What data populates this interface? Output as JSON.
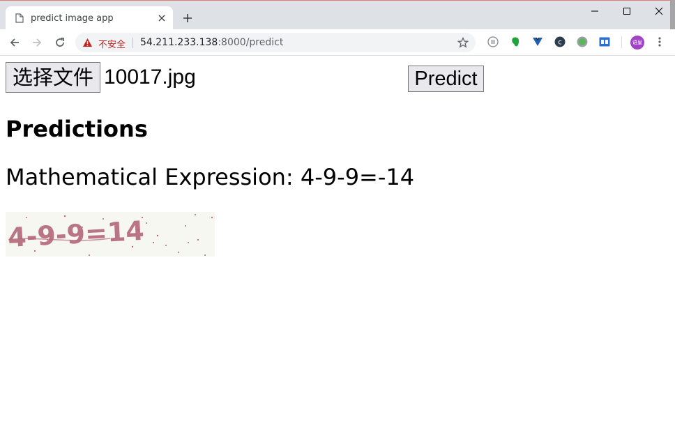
{
  "browser": {
    "tab_title": "predict image app",
    "security_label": "不安全",
    "url_host": "54.211.233.138",
    "url_rest": ":8000/predict",
    "avatar_text": "语皇",
    "extension_icons": [
      "reader-mode-icon",
      "evernote-icon",
      "vuejs-devtools-icon",
      "translate-icon",
      "green-dot-extension-icon",
      "reading-list-icon"
    ]
  },
  "form": {
    "file_button_label": "选择文件",
    "file_name": "10017.jpg",
    "submit_label": "Predict"
  },
  "result": {
    "heading": "Predictions",
    "expression_text": "Mathematical Expression: 4-9-9=-14",
    "captcha_text": "4-9-9=14"
  },
  "colors": {
    "tabstrip_bg": "#dee1e6",
    "insecure_red": "#c5221f",
    "captcha_ink": "#b4687a",
    "captcha_bg": "#f7f7f2"
  }
}
